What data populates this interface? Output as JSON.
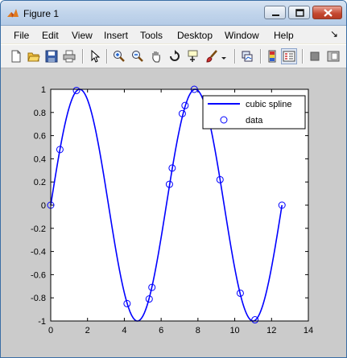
{
  "window": {
    "title": "Figure 1"
  },
  "menu": [
    "File",
    "Edit",
    "View",
    "Insert",
    "Tools",
    "Desktop",
    "Window",
    "Help"
  ],
  "toolbar": {
    "icons": [
      "new-figure-icon",
      "open-file-icon",
      "save-icon",
      "print-icon",
      "edit-plot-arrow-icon",
      "zoom-in-icon",
      "zoom-out-icon",
      "pan-hand-icon",
      "rotate-3d-icon",
      "data-cursor-icon",
      "brush-icon",
      "brush-dropdown-icon",
      "link-plot-icon",
      "insert-colorbar-icon",
      "insert-legend-icon",
      "hide-plot-tools-icon",
      "show-plot-tools-icon"
    ]
  },
  "colors": {
    "series": "#0000ff",
    "figure_bg": "#cbcbcb",
    "axes_bg": "#ffffff"
  },
  "chart_data": {
    "type": "line",
    "title": "",
    "xlabel": "",
    "ylabel": "",
    "xlim": [
      0,
      14
    ],
    "ylim": [
      -1,
      1
    ],
    "xticks": [
      "0",
      "2",
      "4",
      "6",
      "8",
      "10",
      "12",
      "14"
    ],
    "yticks": [
      "-1",
      "-0.8",
      "-0.6",
      "-0.4",
      "-0.2",
      "0",
      "0.2",
      "0.4",
      "0.6",
      "0.8",
      "1"
    ],
    "grid": false,
    "legend": {
      "position": "top-right",
      "entries": [
        "cubic spline",
        "data"
      ]
    },
    "series": [
      {
        "name": "cubic spline",
        "style": "line",
        "color": "#0000ff",
        "function": "sin",
        "x_range": [
          0,
          12.566
        ]
      },
      {
        "name": "data",
        "style": "markers",
        "marker": "circle",
        "color": "#0000ff",
        "x": [
          0,
          0.5,
          1.4,
          4.15,
          5.35,
          5.5,
          6.45,
          6.6,
          7.15,
          7.3,
          7.8,
          9.2,
          10.3,
          11.1,
          12.566
        ],
        "y": [
          0,
          0.48,
          0.99,
          -0.85,
          -0.81,
          -0.71,
          0.18,
          0.32,
          0.79,
          0.86,
          1.0,
          0.22,
          -0.76,
          -0.99,
          0
        ]
      }
    ]
  }
}
